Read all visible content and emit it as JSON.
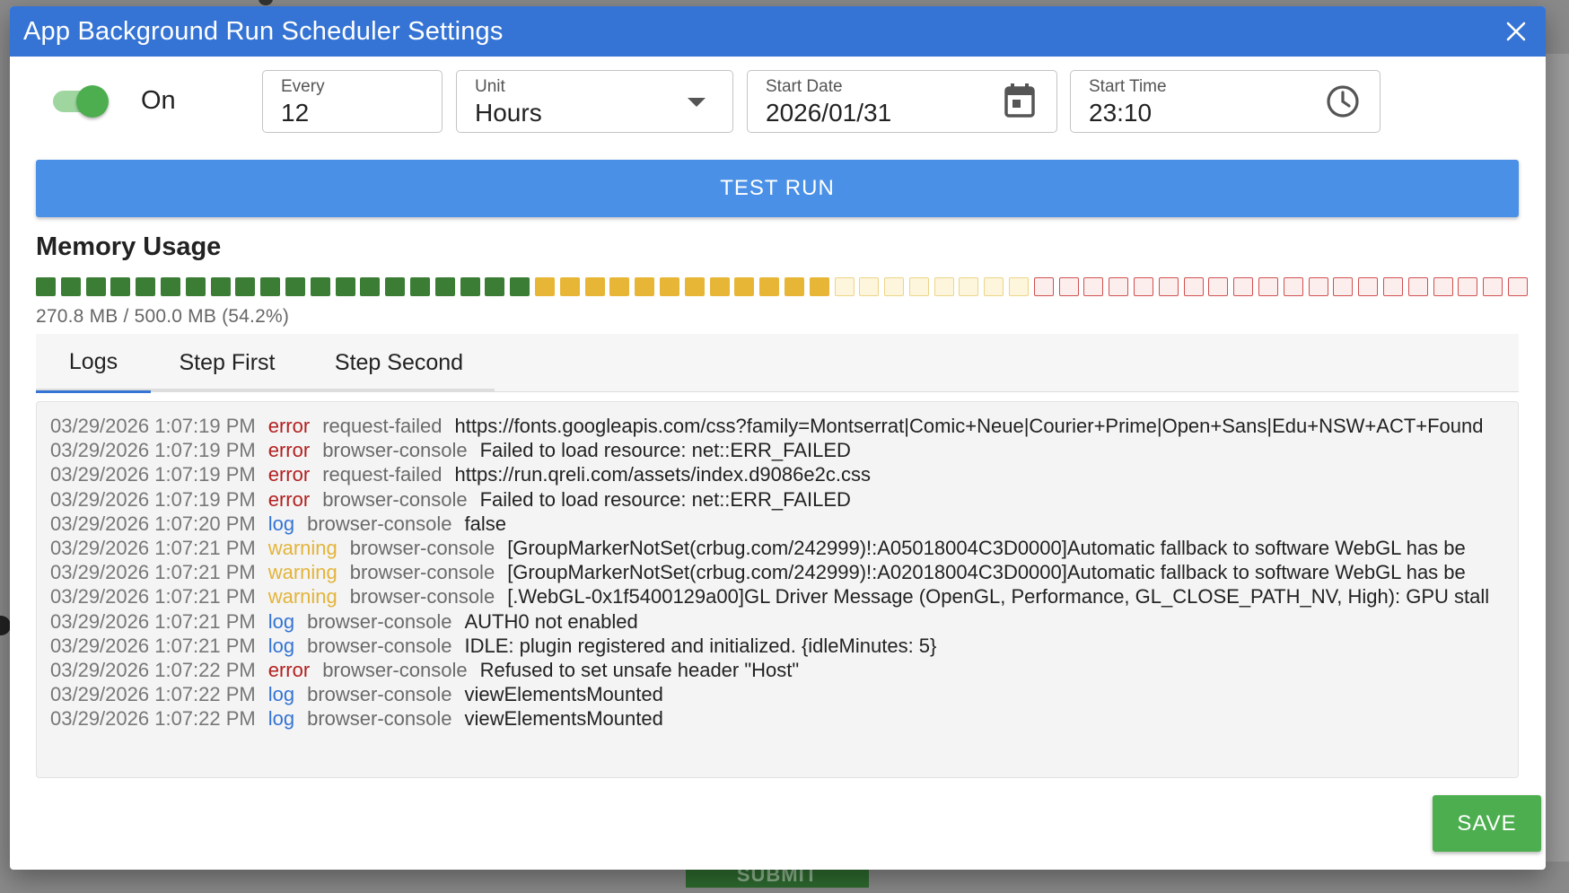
{
  "background": {
    "submit_label": "SUBMIT"
  },
  "dialog": {
    "title": "App Background Run Scheduler Settings",
    "close_icon": "close-icon"
  },
  "schedule": {
    "enabled": true,
    "toggle_label": "On",
    "every_label": "Every",
    "every_value": "12",
    "unit_label": "Unit",
    "unit_value": "Hours",
    "start_date_label": "Start Date",
    "start_date_value": "2026/01/31",
    "start_time_label": "Start Time",
    "start_time_value": "23:10"
  },
  "test_run_label": "TEST RUN",
  "memory": {
    "title": "Memory Usage",
    "summary": "270.8 MB / 500.0 MB (54.2%)",
    "used_fraction": 0.542,
    "cells": {
      "green": 20,
      "yellow": 12,
      "light_yellow": 8,
      "red": 20
    },
    "colors": {
      "green": "#3b7d35",
      "yellow": "#e8b636",
      "light_yellow": "#fdf5dc",
      "red": "#d15050"
    }
  },
  "tabs": [
    {
      "label": "Logs",
      "active": true
    },
    {
      "label": "Step First",
      "active": false
    },
    {
      "label": "Step Second",
      "active": false
    }
  ],
  "logs": [
    {
      "ts": "03/29/2026 1:07:19 PM",
      "level": "error",
      "source": "request-failed",
      "message": "https://fonts.googleapis.com/css?family=Montserrat|Comic+Neue|Courier+Prime|Open+Sans|Edu+NSW+ACT+Found"
    },
    {
      "ts": "03/29/2026 1:07:19 PM",
      "level": "error",
      "source": "browser-console",
      "message": "Failed to load resource: net::ERR_FAILED"
    },
    {
      "ts": "03/29/2026 1:07:19 PM",
      "level": "error",
      "source": "request-failed",
      "message": "https://run.qreli.com/assets/index.d9086e2c.css"
    },
    {
      "ts": "03/29/2026 1:07:19 PM",
      "level": "error",
      "source": "browser-console",
      "message": "Failed to load resource: net::ERR_FAILED"
    },
    {
      "ts": "03/29/2026 1:07:20 PM",
      "level": "log",
      "source": "browser-console",
      "message": "false"
    },
    {
      "ts": "03/29/2026 1:07:21 PM",
      "level": "warning",
      "source": "browser-console",
      "message": "[GroupMarkerNotSet(crbug.com/242999)!:A05018004C3D0000]Automatic fallback to software WebGL has be"
    },
    {
      "ts": "03/29/2026 1:07:21 PM",
      "level": "warning",
      "source": "browser-console",
      "message": "[GroupMarkerNotSet(crbug.com/242999)!:A02018004C3D0000]Automatic fallback to software WebGL has be"
    },
    {
      "ts": "03/29/2026 1:07:21 PM",
      "level": "warning",
      "source": "browser-console",
      "message": "[.WebGL-0x1f5400129a00]GL Driver Message (OpenGL, Performance, GL_CLOSE_PATH_NV, High): GPU stall"
    },
    {
      "ts": "03/29/2026 1:07:21 PM",
      "level": "log",
      "source": "browser-console",
      "message": "AUTH0 not enabled"
    },
    {
      "ts": "03/29/2026 1:07:21 PM",
      "level": "log",
      "source": "browser-console",
      "message": "IDLE: plugin registered and initialized. {idleMinutes: 5}"
    },
    {
      "ts": "03/29/2026 1:07:22 PM",
      "level": "error",
      "source": "browser-console",
      "message": "Refused to set unsafe header \"Host\""
    },
    {
      "ts": "03/29/2026 1:07:22 PM",
      "level": "log",
      "source": "browser-console",
      "message": "viewElementsMounted"
    },
    {
      "ts": "03/29/2026 1:07:22 PM",
      "level": "log",
      "source": "browser-console",
      "message": "viewElementsMounted"
    }
  ],
  "save_label": "SAVE"
}
